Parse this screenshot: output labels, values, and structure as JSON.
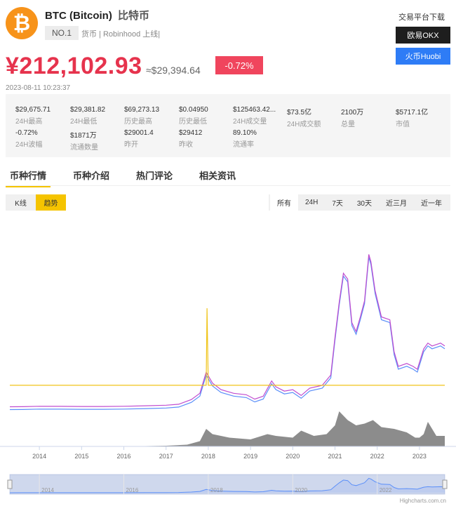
{
  "coin": {
    "symbol_glyph": "₿",
    "name": "BTC (Bitcoin)",
    "name_cn": "比特币",
    "rank": "NO.1",
    "tags": "货币 | Robinhood 上线|"
  },
  "sidebar": {
    "title": "交易平台下载",
    "exchanges": [
      "欧易OKX",
      "火币Huobi"
    ]
  },
  "price": {
    "cny": "¥212,102.93",
    "usd": "≈$29,394.64",
    "change": "-0.72%",
    "timestamp": "2023-08-11 10:23:37"
  },
  "stats": [
    {
      "value": "$29,675.71",
      "label": "24H最高"
    },
    {
      "value": "$29,381.82",
      "label": "24H最低"
    },
    {
      "value": "$69,273.13",
      "label": "历史最高"
    },
    {
      "value": "$0.04950",
      "label": "历史最低"
    },
    {
      "value": "$125463.42...",
      "label": "24H成交量"
    },
    {
      "value": "$73.5亿",
      "label": "24H成交额"
    },
    {
      "value": "2100万",
      "label": "总量"
    },
    {
      "value": "$5717.1亿",
      "label": "市值"
    },
    {
      "value": "-0.72%",
      "label": "24H波幅"
    },
    {
      "value": "$1871万",
      "label": "流通数量"
    },
    {
      "value": "$29001.4",
      "label": "昨开"
    },
    {
      "value": "$29412",
      "label": "昨收"
    },
    {
      "value": "89.10%",
      "label": "流通率"
    }
  ],
  "tabs": [
    "币种行情",
    "币种介绍",
    "热门评论",
    "相关资讯"
  ],
  "chart_type_buttons": [
    "K线",
    "趋势"
  ],
  "range_buttons": [
    "所有",
    "24H",
    "7天",
    "30天",
    "近三月",
    "近一年"
  ],
  "chart_credit": "Highcharts.com.cn",
  "colors": {
    "price_red": "#e6334d",
    "accent_yellow": "#f5c400",
    "btc_orange": "#f7931a",
    "line_blue": "#5b8ff9",
    "line_purple": "#c04ccf"
  },
  "chart_data": {
    "type": "line",
    "x_ticks": [
      "2014",
      "2015",
      "2016",
      "2017",
      "2018",
      "2019",
      "2020",
      "2021",
      "2022",
      "2023"
    ],
    "navigator_ticks": [
      "2014",
      "2016",
      "2018",
      "2020",
      "2022"
    ],
    "price_series": {
      "x": [
        2013.3,
        2013.6,
        2014.0,
        2014.5,
        2015.0,
        2015.5,
        2016.0,
        2016.5,
        2017.0,
        2017.3,
        2017.6,
        2017.8,
        2017.95,
        2018.1,
        2018.3,
        2018.6,
        2018.9,
        2019.1,
        2019.3,
        2019.5,
        2019.6,
        2019.8,
        2020.0,
        2020.2,
        2020.4,
        2020.7,
        2020.9,
        2021.0,
        2021.1,
        2021.2,
        2021.3,
        2021.4,
        2021.5,
        2021.6,
        2021.7,
        2021.8,
        2021.85,
        2021.95,
        2022.1,
        2022.3,
        2022.4,
        2022.5,
        2022.7,
        2022.85,
        2022.95,
        2023.1,
        2023.2,
        2023.3,
        2023.5,
        2023.6
      ],
      "values": [
        0.25,
        0.3,
        0.6,
        0.55,
        0.45,
        0.45,
        0.6,
        0.9,
        1.3,
        2.0,
        5.2,
        9.5,
        24.0,
        16.5,
        12.0,
        9.5,
        8.5,
        5.5,
        7.5,
        18.0,
        14.0,
        11.0,
        12.0,
        8.0,
        13.0,
        15.0,
        22.0,
        48.0,
        72.0,
        92.0,
        88.0,
        58.0,
        52.0,
        62.0,
        73.0,
        105.0,
        100.0,
        80.0,
        62.0,
        60.0,
        38.0,
        28.0,
        30.0,
        28.0,
        26.0,
        40.0,
        44.0,
        42.0,
        44.0,
        42.0
      ]
    },
    "yellow_line": {
      "x": [
        2013.3,
        2017.95,
        2017.97,
        2018.0,
        2018.02,
        2023.6
      ],
      "values": [
        15.0,
        15.0,
        68.0,
        15.0,
        15.0,
        15.0
      ]
    },
    "volume_series": {
      "x": [
        2013.3,
        2016.0,
        2017.0,
        2017.5,
        2017.8,
        2017.95,
        2018.1,
        2018.5,
        2019.0,
        2019.4,
        2019.6,
        2020.0,
        2020.2,
        2020.5,
        2020.8,
        2021.0,
        2021.1,
        2021.3,
        2021.5,
        2021.7,
        2021.9,
        2022.1,
        2022.4,
        2022.7,
        2022.9,
        2023.0,
        2023.1,
        2023.2,
        2023.4,
        2023.6
      ],
      "values": [
        0,
        0,
        0.02,
        0.05,
        0.15,
        0.5,
        0.35,
        0.25,
        0.2,
        0.35,
        0.3,
        0.25,
        0.45,
        0.3,
        0.35,
        0.6,
        1.0,
        0.75,
        0.6,
        0.65,
        0.75,
        0.55,
        0.5,
        0.4,
        0.25,
        0.25,
        0.35,
        0.7,
        0.3,
        0.3
      ]
    }
  }
}
